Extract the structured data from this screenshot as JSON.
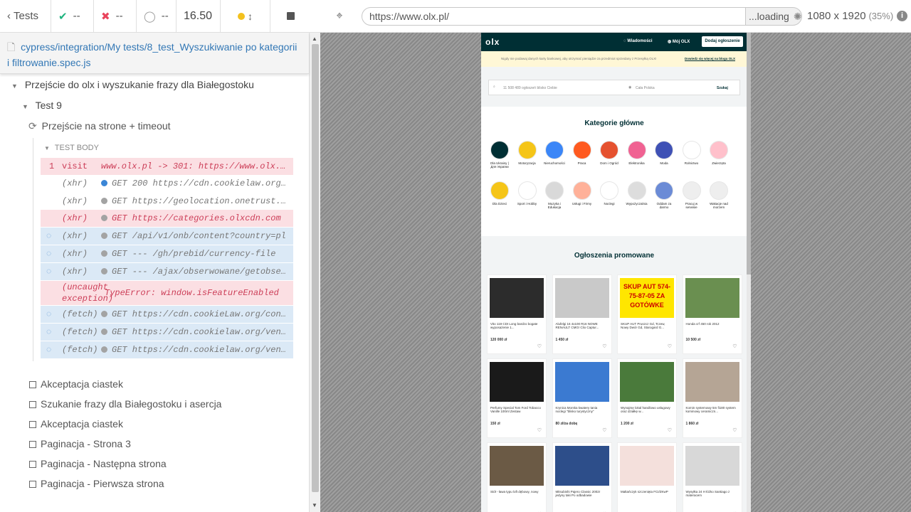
{
  "topbar": {
    "tests_label": "Tests",
    "passed": "--",
    "failed": "--",
    "pending": "--",
    "duration": "16.50"
  },
  "browser": {
    "url": "https://www.olx.pl/",
    "loading": "...loading",
    "viewport": "1080 x 1920",
    "zoom": "(35%)"
  },
  "spec": {
    "path": "cypress/integration/My tests/8_test_Wyszukiwanie po kategorii i filtrowanie.spec.js"
  },
  "suite": {
    "title": "Przejście do olx i wyszukanie frazy dla Białegostoku",
    "test": "Test 9",
    "hook": "Przejście na strone + timeout",
    "body_label": "TEST BODY"
  },
  "commands": [
    {
      "num": "1",
      "label": "visit",
      "msg": "www.olx.pl -> 301: https://www.olx.pl/",
      "style": "red"
    },
    {
      "num": "",
      "label": "(xhr)",
      "msg": "GET 200 https://cdn.cookielaw.org/consent/",
      "style": "plain"
    },
    {
      "num": "",
      "label": "(xhr)",
      "msg": "GET https://geolocation.onetrust.com",
      "style": "plain"
    },
    {
      "num": "",
      "label": "(xhr)",
      "msg": "GET https://categories.olxcdn.com",
      "style": "red"
    },
    {
      "num": "",
      "label": "(xhr)",
      "msg": "GET /api/v1/onb/content?country=pl",
      "style": "blue"
    },
    {
      "num": "",
      "label": "(xhr)",
      "msg": "GET --- /gh/prebid/currency-file",
      "style": "blue"
    },
    {
      "num": "",
      "label": "(xhr)",
      "msg": "GET --- /ajax/obserwowane/getobserved",
      "style": "blue"
    },
    {
      "num": "",
      "label": "(uncaught exception)",
      "msg": "TypeError: window.isFeatureEnabled",
      "style": "red"
    },
    {
      "num": "",
      "label": "(fetch)",
      "msg": "GET https://cdn.cookieLaw.org/consent/",
      "style": "blue"
    },
    {
      "num": "",
      "label": "(fetch)",
      "msg": "GET https://cdn.cookielaw.org/vendor",
      "style": "blue"
    },
    {
      "num": "",
      "label": "(fetch)",
      "msg": "GET https://cdn.cookielaw.org/vendor",
      "style": "blue"
    }
  ],
  "steps": [
    "Akceptacja ciastek",
    "Szukanie frazy dla Białegostoku i asercja",
    "Akceptacja ciastek",
    "Paginacja - Strona 3",
    "Paginacja - Następna strona",
    "Paginacja - Pierwsza strona"
  ],
  "olx": {
    "logo": "olx",
    "messages": "Wiadomości",
    "my_olx": "Mój OLX",
    "add_ad": "Dodaj ogłoszenie",
    "notice": "Nigdy nie podawaj danych karty bankowej, aby otrzymać pieniądze za przedmiot sprzedany z Przesyłką OLX!",
    "notice_link": "Dowiedz się więcej na blogu OLX",
    "search_placeholder": "11 508 489 ogłoszeń blisko Ciebie",
    "location": "Cała Polska",
    "search_btn": "Szukaj",
    "categories_title": "Kategorie główne",
    "categories_row1": [
      "Dla Ukrainy | Для України",
      "Motoryzacja",
      "Nieruchomości",
      "Praca",
      "Dom i Ogród",
      "Elektronika",
      "Moda",
      "Rolnictwo",
      "Zwierzęta"
    ],
    "categories_row2": [
      "Dla Dzieci",
      "Sport i Hobby",
      "Muzyka i Edukacja",
      "Usługi i Firmy",
      "Noclegi",
      "Wypożyczalnia",
      "Oddam za darmo",
      "Pracuj w serwisie",
      "Wakacje nad morzem"
    ],
    "promoted_title": "Ogłoszenia promowane",
    "ads": [
      {
        "title": "Vito 119 CDI Long bardzo bogate wyposażenie 1...",
        "price": "120 000 zł"
      },
      {
        "title": "Alufelgi 16 4x100 R16 NOWE RENAULT CMG! Clio Captur...",
        "price": "1 450 zł"
      },
      {
        "title": "SKUP AUT Pruszcz Gd, Tczew, Nowy Dwór Gd, Starogard G...",
        "price": "",
        "banner": "SKUP AUT 574-75-87-05 ZA GOTÓWKE"
      },
      {
        "title": "Honda crf 450 rok 2012",
        "price": "10 500 zł"
      },
      {
        "title": "Perfumy Special Tom Ford Tobacco Vanille 100ml Zestaw",
        "price": "150 zł"
      },
      {
        "title": "Krynica Morska kwatery tania noclegi \"blisko turystyczny\"",
        "price": "80 zł/za dobę"
      },
      {
        "title": "Wynajmę lokal handlowo usługowy oraz działkę w...",
        "price": "1 200 zł"
      },
      {
        "title": "Komin systemowy 5m fi180 system kominowy ceramiczn...",
        "price": "1 860 zł"
      },
      {
        "title": "Stół - ława typu loft dębowy, nowy",
        "price": ""
      },
      {
        "title": "Mitsubishi Pajero Classic 2002r jedyny taki Po odbadowie",
        "price": ""
      },
      {
        "title": "Maltańczyk szczenięta FCI/ZKwP",
        "price": ""
      },
      {
        "title": "Wysyłka 24 H łóżko Santiago z materacem",
        "price": ""
      }
    ]
  }
}
